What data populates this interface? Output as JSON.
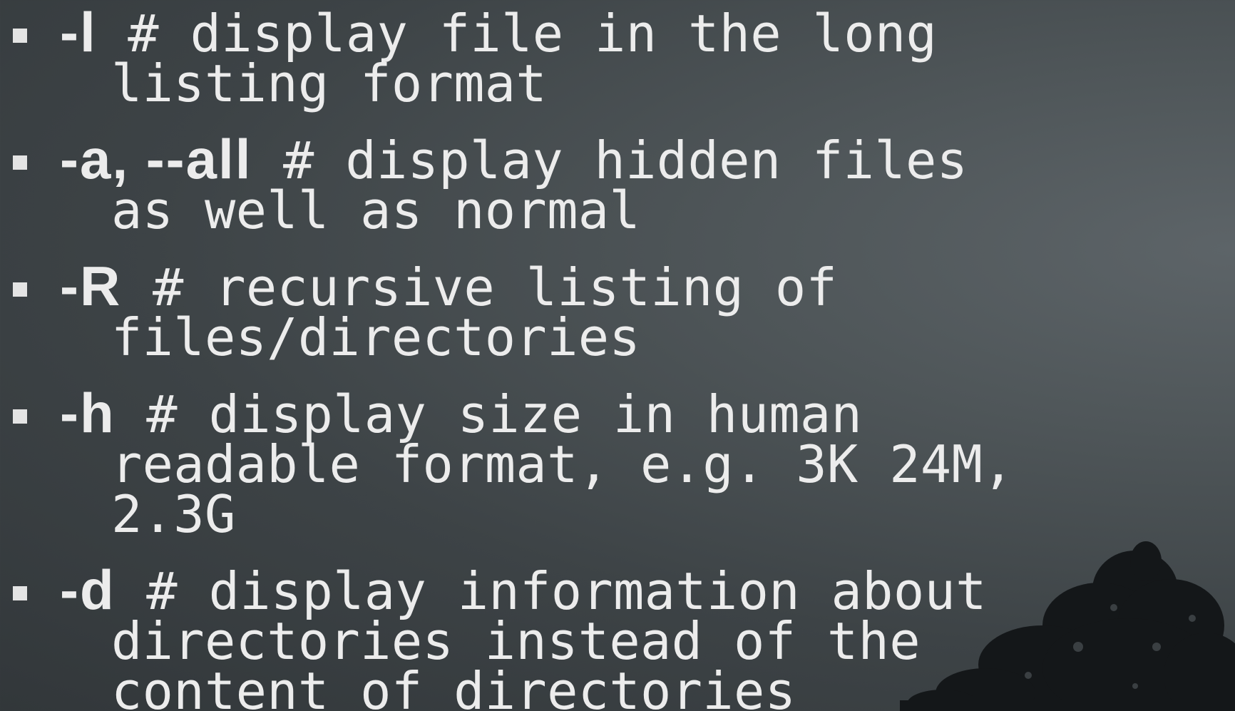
{
  "items": [
    {
      "flag": "-l",
      "line1": " # display file in the long",
      "lines": [
        "listing format"
      ]
    },
    {
      "flag": "-a, --all",
      "line1": " # display hidden files",
      "lines": [
        "as well as normal"
      ]
    },
    {
      "flag": "-R",
      "line1": " # recursive listing of",
      "lines": [
        "files/directories"
      ]
    },
    {
      "flag": "-h",
      "line1": " # display size in human",
      "lines": [
        "readable format, e.g. 3K 24M,",
        "2.3G"
      ]
    },
    {
      "flag": "-d",
      "line1": " # display information about",
      "lines": [
        "directories instead of the",
        "content of directories"
      ]
    }
  ]
}
